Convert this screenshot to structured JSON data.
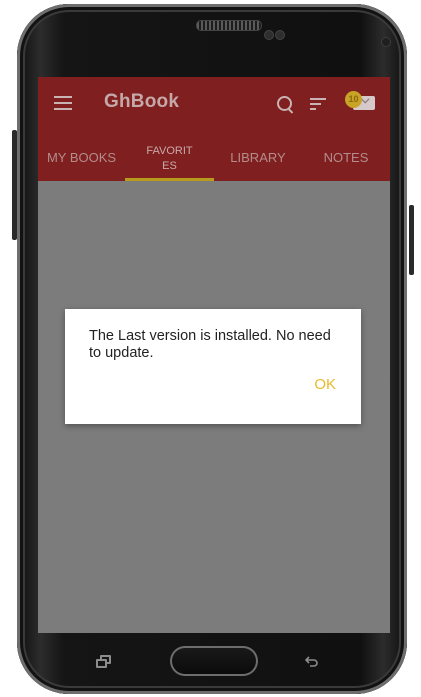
{
  "app": {
    "title": "GhBook",
    "notification_count": "10"
  },
  "tabs": [
    {
      "label": "MY BOOKS",
      "active": false
    },
    {
      "label": "FAVORITES",
      "active": true
    },
    {
      "label": "LIBRARY",
      "active": false
    },
    {
      "label": "NOTES",
      "active": false
    }
  ],
  "dialog": {
    "message": "The Last version is installed. No need to update.",
    "ok_label": "OK"
  },
  "icons": {
    "menu": "menu-icon",
    "search": "search-icon",
    "sort": "filter-icon",
    "notifications": "notification-icon",
    "recent_apps": "recent-apps-icon",
    "home": "home-button",
    "back": "back-icon"
  },
  "colors": {
    "toolbar": "#7f1f1f",
    "accent": "#e8b92c",
    "scrim": "#7c7c7c"
  }
}
